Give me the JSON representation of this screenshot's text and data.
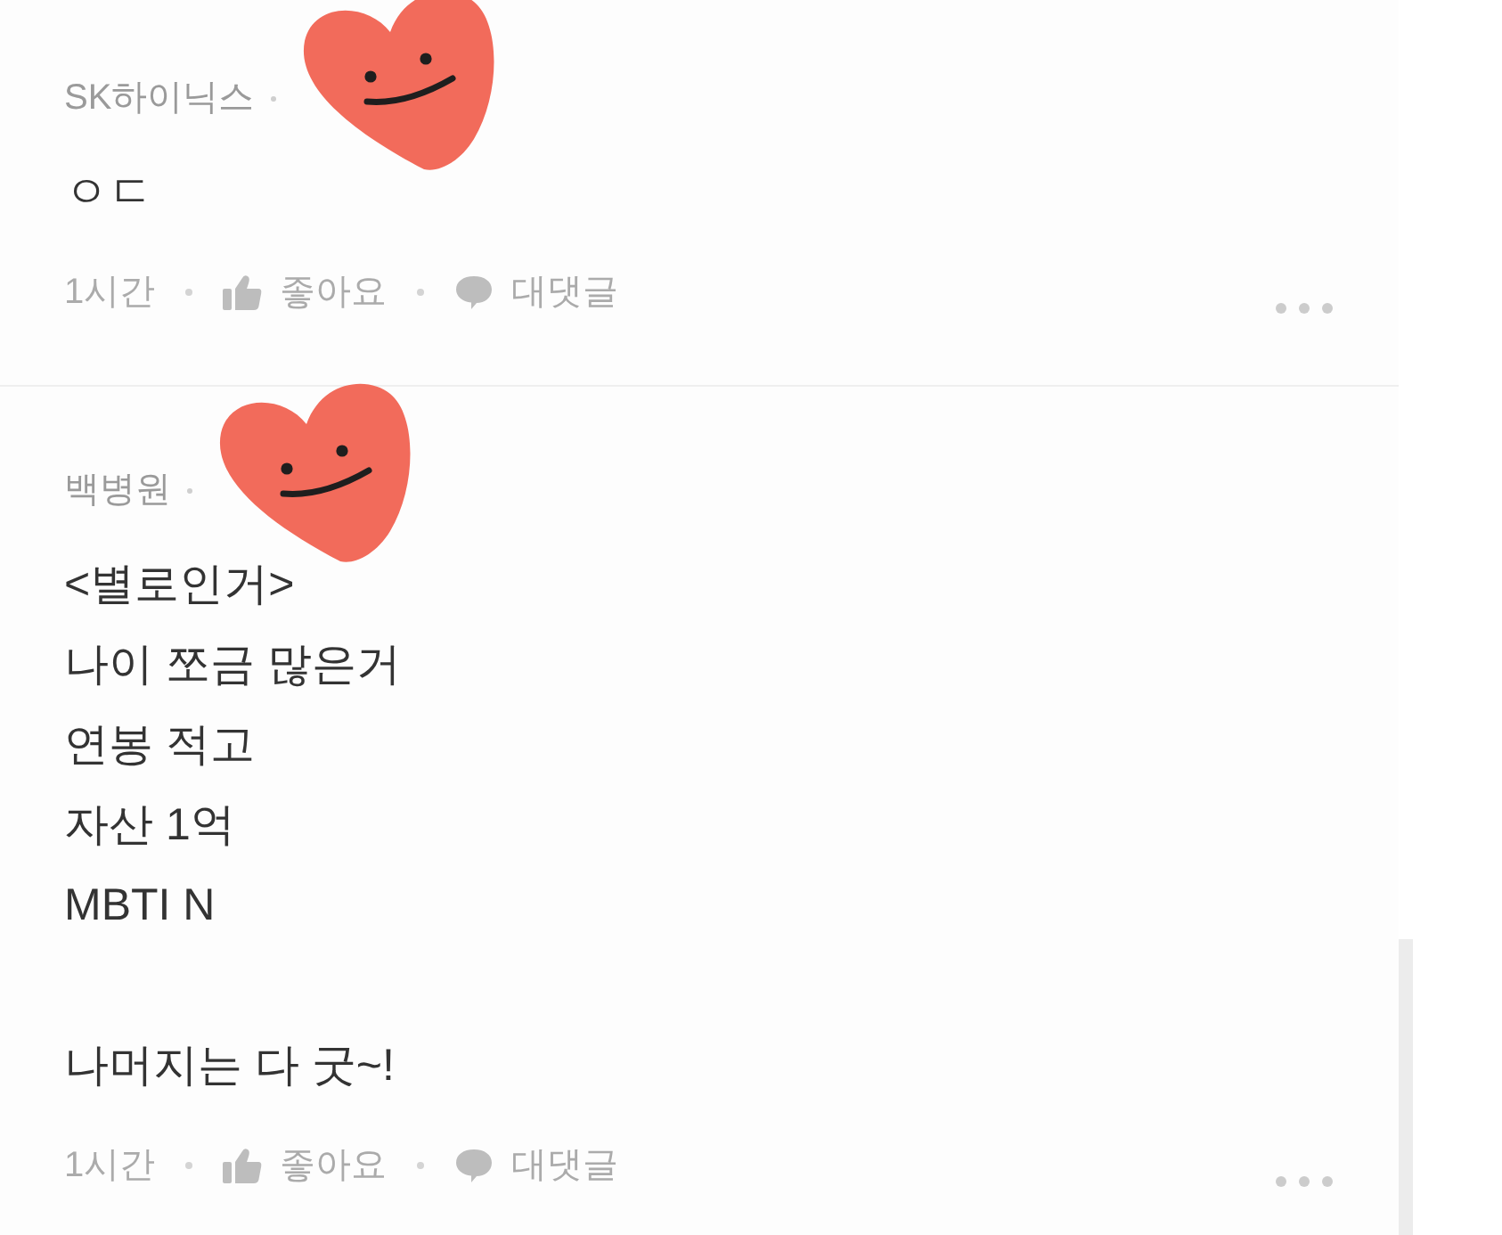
{
  "comments": [
    {
      "author": "SK하이닉스",
      "redacted": true,
      "body": "ㅇㄷ",
      "time": "1시간",
      "like_label": "좋아요",
      "reply_label": "대댓글"
    },
    {
      "author": "백병원",
      "redacted": true,
      "body": "<별로인거>\n나이 쪼금 많은거\n연봉 적고\n자산 1억\nMBTI N\n\n나머지는 다 굿~!",
      "time": "1시간",
      "like_label": "좋아요",
      "reply_label": "대댓글"
    }
  ]
}
